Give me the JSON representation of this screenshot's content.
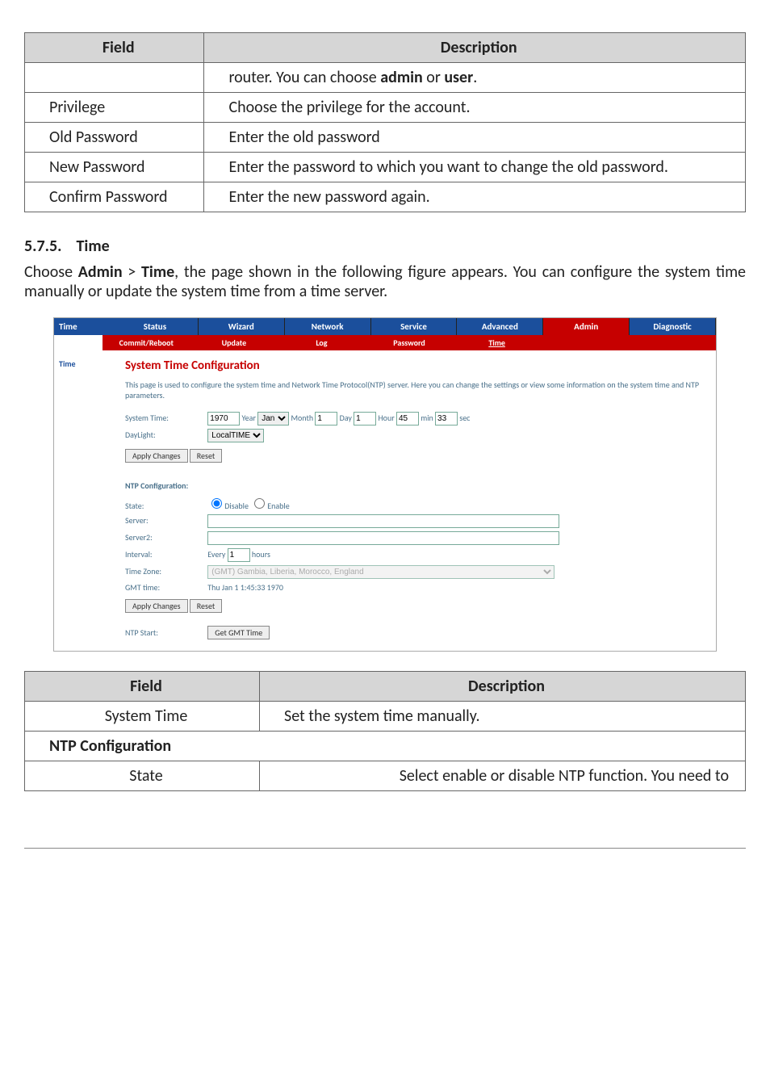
{
  "table1": {
    "h1": "Field",
    "h2": "Description",
    "rows": [
      {
        "f": "",
        "d_pre": "router. You can choose ",
        "d_b1": "admin",
        "d_mid": " or ",
        "d_b2": "user",
        "d_post": "."
      },
      {
        "f": "Privilege",
        "d": "Choose the privilege for the account."
      },
      {
        "f": "Old Password",
        "d": "Enter the old password"
      },
      {
        "f": "New Password",
        "d": "Enter the password to which you want to change the old password."
      },
      {
        "f": "Confirm Password",
        "d": "Enter the new password again."
      }
    ]
  },
  "section_num": "5.7.5.",
  "section_title": "Time",
  "body_pre": "Choose ",
  "body_b1": "Admin",
  "body_gt": " > ",
  "body_b2": "Time",
  "body_post": ", the page shown in the following figure appears. You can configure the system time manually or update the system time from a time server.",
  "shot": {
    "nav_side": "Time",
    "tabs": [
      "Status",
      "Wizard",
      "Network",
      "Service",
      "Advanced",
      "Admin",
      "Diagnostic"
    ],
    "active_tab": "Admin",
    "subtabs": [
      "Commit/Reboot",
      "Update",
      "Log",
      "Password",
      "Time"
    ],
    "active_sub": "Time",
    "side_item": "Time",
    "title": "System Time Configuration",
    "intro": "This page is used to configure the system time and Network Time Protocol(NTP) server. Here you can change the settings or view some information on the system time and NTP parameters.",
    "systime_label": "System Time:",
    "year_val": "1970",
    "year_lbl": "Year",
    "month_sel": "Jan",
    "month_lbl": "Month",
    "month_val": "1",
    "day_lbl": "Day",
    "day_val": "1",
    "hour_lbl": "Hour",
    "hour_val": "45",
    "min_lbl": "min",
    "min_val": "33",
    "sec_lbl": "sec",
    "daylight_lbl": "DayLight:",
    "daylight_sel": "LocalTIME",
    "apply_btn": "Apply Changes",
    "reset_btn": "Reset",
    "ntp_heading": "NTP Configuration:",
    "state_lbl": "State:",
    "state_opt_dis": "Disable",
    "state_opt_en": "Enable",
    "server_lbl": "Server:",
    "server2_lbl": "Server2:",
    "interval_lbl": "Interval:",
    "interval_pre": "Every",
    "interval_val": "1",
    "interval_unit": "hours",
    "tz_lbl": "Time Zone:",
    "tz_val": "(GMT) Gambia, Liberia, Morocco, England",
    "gmt_lbl": "GMT time:",
    "gmt_val": "Thu Jan 1 1:45:33 1970",
    "ntp_start_lbl": "NTP Start:",
    "get_gmt_btn": "Get GMT Time"
  },
  "table2": {
    "h1": "Field",
    "h2": "Description",
    "rows": [
      {
        "f": "System Time",
        "d": "Set the system time manually."
      },
      {
        "f_section": "NTP Configuration"
      },
      {
        "f": "State",
        "d": "Select enable or disable NTP function. You need to"
      }
    ]
  }
}
